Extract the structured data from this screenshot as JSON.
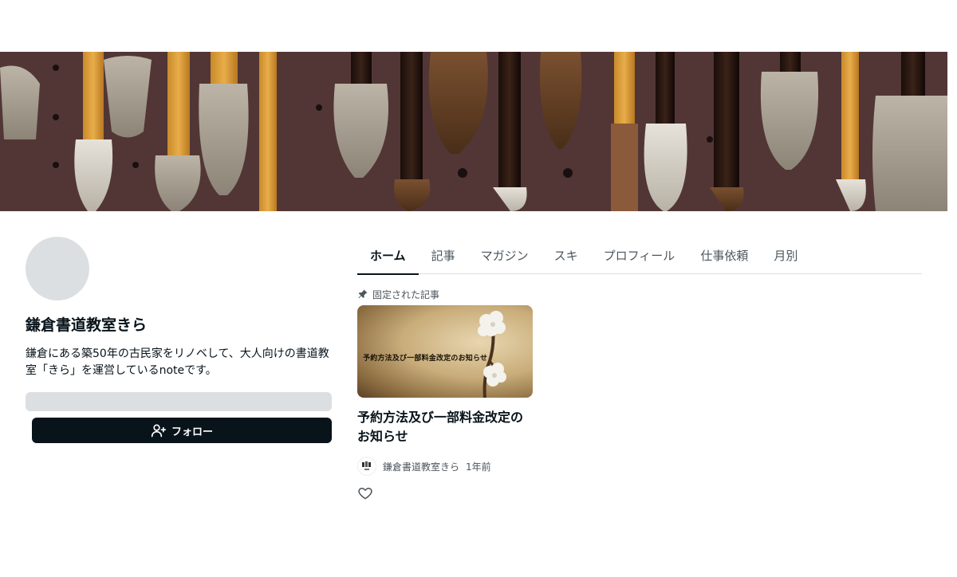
{
  "creator": {
    "name": "鎌倉書道教室きら",
    "bio": "鎌倉にある築50年の古民家をリノベして、大人向けの書道教室「きら」を運営しているnoteです。",
    "follow_label": "フォロー"
  },
  "tabs": [
    {
      "label": "ホーム",
      "active": true
    },
    {
      "label": "記事",
      "active": false
    },
    {
      "label": "マガジン",
      "active": false
    },
    {
      "label": "スキ",
      "active": false
    },
    {
      "label": "プロフィール",
      "active": false
    },
    {
      "label": "仕事依頼",
      "active": false
    },
    {
      "label": "月別",
      "active": false
    }
  ],
  "pinned": {
    "label": "固定された記事",
    "article": {
      "thumbnail_text": "予約方法及び一部料金改定のお知らせ",
      "title": "予約方法及び一部料金改定のお知らせ",
      "author": "鎌倉書道教室きら",
      "time": "1年前"
    }
  },
  "icons": {
    "follow": "user-plus-icon",
    "pin": "pin-icon",
    "like": "heart-icon"
  },
  "colors": {
    "primary": "#08131a",
    "muted": "#4c555c",
    "placeholder": "#dcdfe2"
  }
}
